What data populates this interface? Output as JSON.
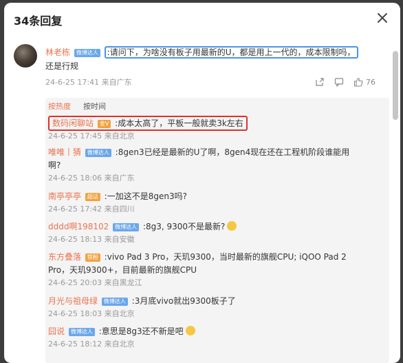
{
  "dialog": {
    "title": "34条回复"
  },
  "main_post": {
    "user": "林老栋",
    "badge": "微博达人",
    "text_highlight": ":请问下，为啥没有板子用最新的U，都是用上一代的，成本限制吗，",
    "text_rest": "还是行规",
    "meta": "24-6-25 17:41 来自广东",
    "like_count": "76"
  },
  "sort_tabs": [
    "按热度",
    "按时间"
  ],
  "replies": [
    {
      "user": "数码闲聊站",
      "badge": "金V",
      "text": ":成本太高了，平板一般就卖3k左右",
      "meta": "24-6-25 17:45 来自北京",
      "highlight": true
    },
    {
      "user": "唯唯丨猜",
      "badge": "微博达人",
      "text": ":8gen3已经是最新的U了啊，8gen4现在还在工程机阶段谁能用",
      "text2": "啊?",
      "meta": "24-6-25 18:06 来自广东"
    },
    {
      "user": "南亭亭亭",
      "badge": "超话",
      "text": ":一加这不是8gen3吗?",
      "meta": "24-6-25 17:42 来自四川"
    },
    {
      "user": "dddd啊198102",
      "badge": "微博达人",
      "text": ":8g3, 9300不是最新?",
      "emoji": true,
      "meta": "24-6-25 18:13 来自安徽"
    },
    {
      "user": "东方叠落",
      "badge": "铁粉",
      "text": ":vivo Pad 3 Pro，天玑9300，当时最新的旗舰CPU; iQOO Pad 2",
      "text2": "Pro，天玑9300+，目前最新的旗舰CPU",
      "meta": "24-6-25 20:03 来自黑龙江"
    },
    {
      "user": "月光与祖母绿",
      "badge": "微博达人",
      "text": ":3月底vivo就出9300板子了",
      "meta": "24-6-25 18:03 来自北京"
    },
    {
      "user": "囧说",
      "badge": "微博达人",
      "text": ":意思是8g3还不新是吧",
      "emoji": true,
      "meta": "24-6-25 18:12 来自北京"
    }
  ]
}
